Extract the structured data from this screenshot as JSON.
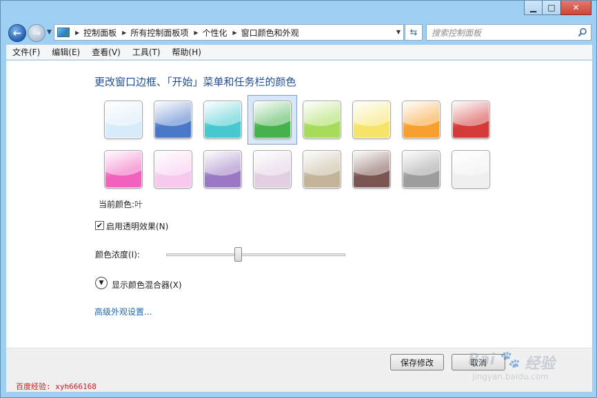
{
  "window": {
    "min_label": "▁",
    "max_label": "□",
    "close_label": "✕"
  },
  "address": {
    "crumbs": [
      "控制面板",
      "所有控制面板项",
      "个性化",
      "窗口颜色和外观"
    ],
    "search_placeholder": "搜索控制面板"
  },
  "menu": [
    "文件(F)",
    "编辑(E)",
    "查看(V)",
    "工具(T)",
    "帮助(H)"
  ],
  "content": {
    "title": "更改窗口边框、「开始」菜单和任务栏的颜色",
    "swatches": [
      {
        "color": "#d8ebfb"
      },
      {
        "color": "#4a78c8"
      },
      {
        "color": "#47c9cf"
      },
      {
        "color": "#46b24e"
      },
      {
        "color": "#a6dc5a"
      },
      {
        "color": "#f6e46a"
      },
      {
        "color": "#f7a02f"
      },
      {
        "color": "#d43a3a"
      },
      {
        "color": "#f162be"
      },
      {
        "color": "#f8c9ef"
      },
      {
        "color": "#9a78c3"
      },
      {
        "color": "#e2cfe2"
      },
      {
        "color": "#c3b499"
      },
      {
        "color": "#7b5551"
      },
      {
        "color": "#9d9d9d"
      },
      {
        "color": "#efefef"
      }
    ],
    "selected_index": 3,
    "current_color_label": "当前颜色:",
    "current_color_value": "叶",
    "transparency_label": "启用透明效果(N)",
    "transparency_checked": true,
    "intensity_label": "颜色浓度(I):",
    "intensity_value": 0.4,
    "mixer_label": "显示颜色混合器(X)",
    "advanced_link": "高级外观设置..."
  },
  "footer": {
    "save_label": "保存修改",
    "cancel_label": "取消",
    "watermark": "百度经验: xyh666168",
    "logo_text": "Bai",
    "logo_text2": "经验",
    "logo_url": "jingyan.baidu.com"
  }
}
